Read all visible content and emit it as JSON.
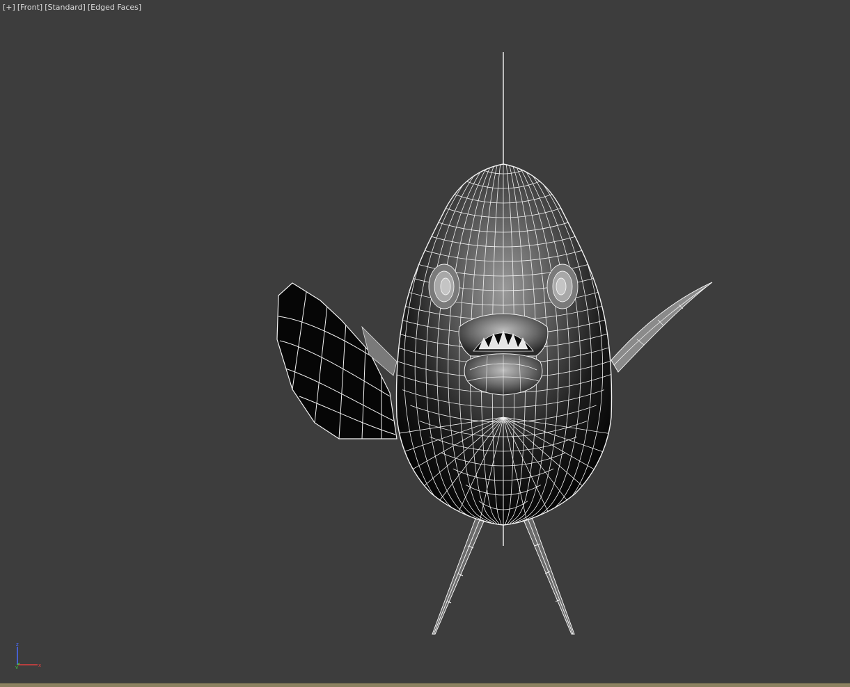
{
  "viewport": {
    "label_parts": [
      "[+]",
      "[Front]",
      "[Standard]",
      "[Edged Faces]"
    ]
  },
  "axis_gizmo": {
    "z_label": "z",
    "y_label": "y",
    "x_label": "x",
    "colors": {
      "z": "#4a6cff",
      "y": "#3ccf3c",
      "x": "#e04040"
    }
  },
  "scene": {
    "object": "fish-model",
    "shading": "edged-faces",
    "wire_color": "#f2f2f2"
  },
  "colors": {
    "viewport_bg": "#3d3d3d",
    "active_border": "#b5a86e"
  }
}
